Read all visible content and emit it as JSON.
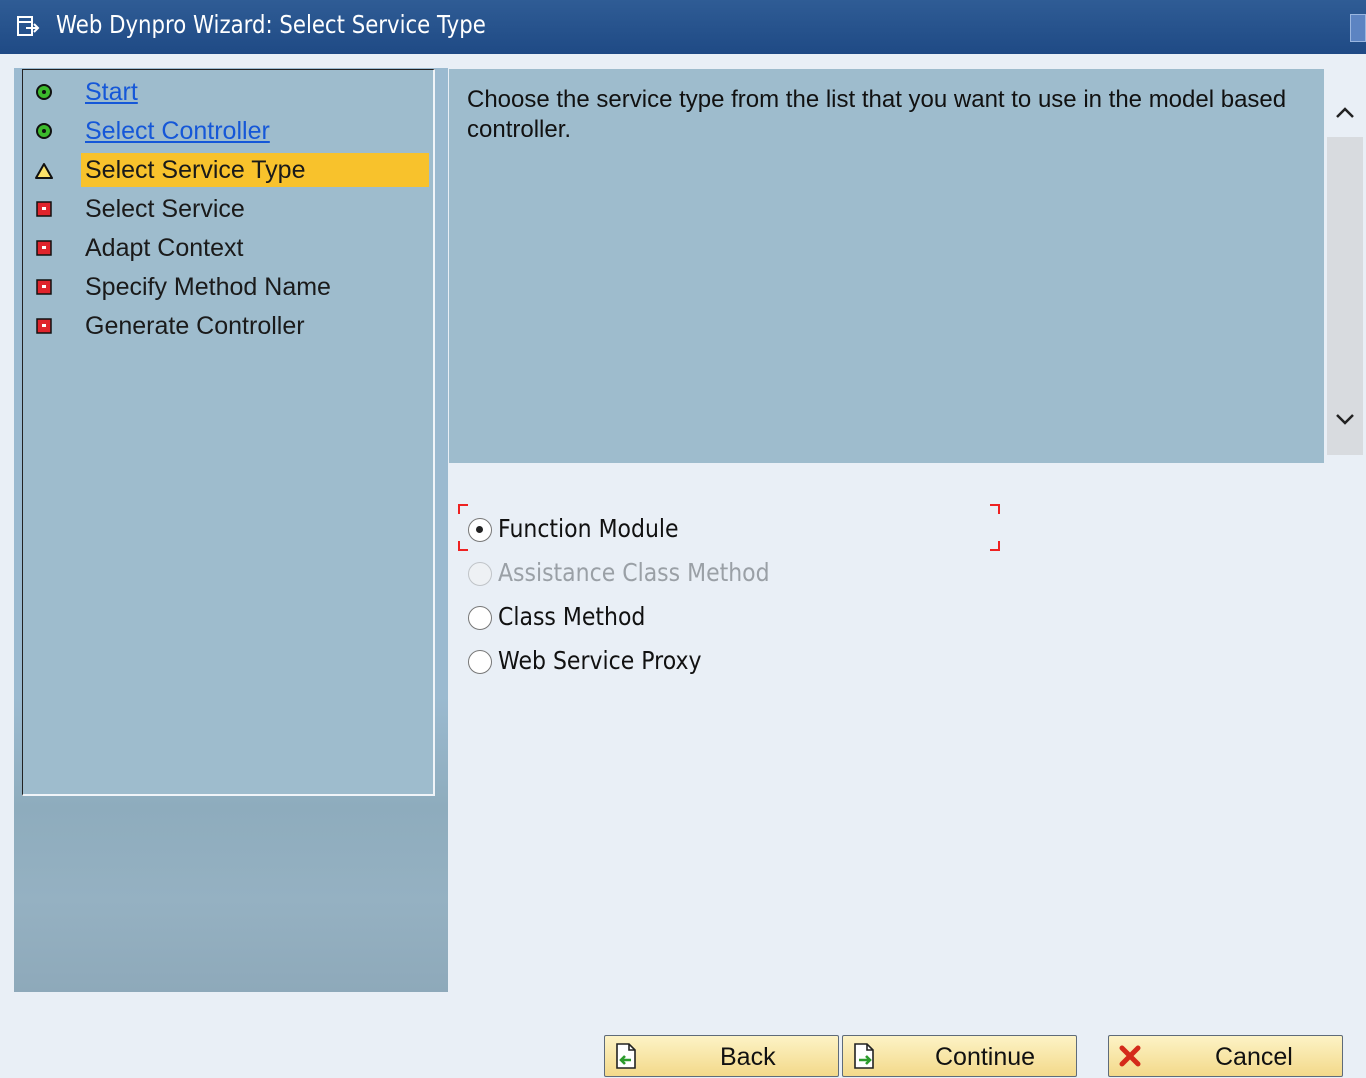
{
  "window": {
    "title": "Web Dynpro Wizard: Select Service Type",
    "title_icon": "wizard-icon",
    "titlebar_color": "#2a5690"
  },
  "steps": [
    {
      "label": "Start",
      "status": "completed",
      "icon": "green-circle-icon",
      "link": true
    },
    {
      "label": "Select Controller",
      "status": "completed",
      "icon": "green-circle-icon",
      "link": true
    },
    {
      "label": "Select Service Type",
      "status": "current",
      "icon": "warning-triangle-icon",
      "link": false
    },
    {
      "label": "Select Service",
      "status": "pending",
      "icon": "red-square-icon",
      "link": false
    },
    {
      "label": "Adapt Context",
      "status": "pending",
      "icon": "red-square-icon",
      "link": false
    },
    {
      "label": "Specify Method Name",
      "status": "pending",
      "icon": "red-square-icon",
      "link": false
    },
    {
      "label": "Generate Controller",
      "status": "pending",
      "icon": "red-square-icon",
      "link": false
    }
  ],
  "description": "Choose the service type from the list that you want to use in the model based controller.",
  "service_types": [
    {
      "label": "Function Module",
      "selected": true,
      "enabled": true
    },
    {
      "label": "Assistance Class Method",
      "selected": false,
      "enabled": false
    },
    {
      "label": "Class Method",
      "selected": false,
      "enabled": true
    },
    {
      "label": "Web Service Proxy",
      "selected": false,
      "enabled": true
    }
  ],
  "buttons": {
    "back": {
      "label": "Back",
      "icon": "back-page-icon"
    },
    "continue": {
      "label": "Continue",
      "icon": "continue-page-icon"
    },
    "cancel": {
      "label": "Cancel",
      "icon": "red-x-icon"
    }
  },
  "colors": {
    "active_step_highlight": "#f8c22c",
    "link": "#1557d8",
    "panel": "#9ebccd",
    "background": "#e9eff6"
  }
}
